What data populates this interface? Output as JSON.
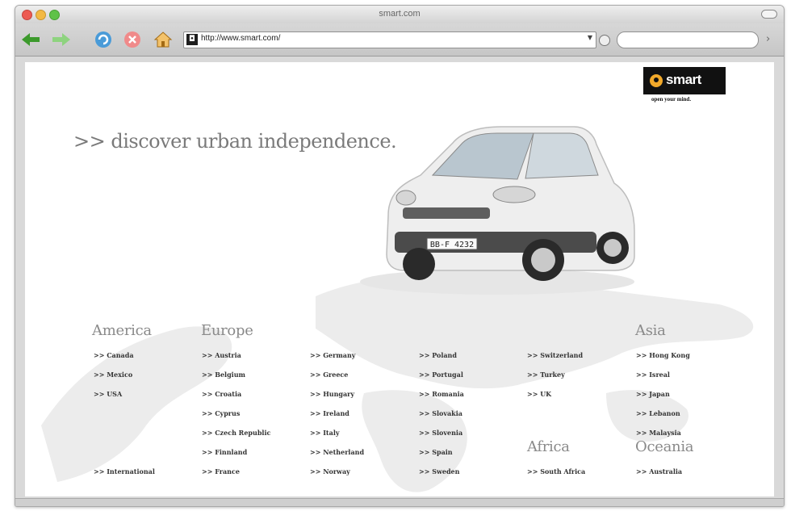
{
  "browser": {
    "title": "smart.com",
    "url": "http://www.smart.com/"
  },
  "brand": {
    "logo_text": "smart",
    "tagline": "open your mind.",
    "accent": "#f2a92a"
  },
  "hero": {
    "headline": ">> discover urban independence.",
    "license_plate": "BB-F 4232"
  },
  "regions": {
    "america": {
      "label": "America",
      "links": [
        ">> Canada",
        ">> Mexico",
        ">> USA"
      ]
    },
    "europe": {
      "label": "Europe"
    },
    "asia": {
      "label": "Asia",
      "links": [
        ">> Hong Kong",
        ">> Isreal",
        ">> Japan",
        ">> Lebanon",
        ">> Malaysia"
      ]
    },
    "africa": {
      "label": "Africa",
      "links": [
        ">> South Africa"
      ]
    },
    "oceania": {
      "label": "Oceania",
      "links": [
        ">> Australia"
      ]
    },
    "international": ">> International"
  },
  "europe_cols": [
    [
      ">> Austria",
      ">> Belgium",
      ">> Croatia",
      ">> Cyprus",
      ">> Czech Republic",
      ">> Finnland",
      ">> France"
    ],
    [
      ">> Germany",
      ">> Greece",
      ">> Hungary",
      ">> Ireland",
      ">> Italy",
      ">> Netherland",
      ">> Norway"
    ],
    [
      ">> Poland",
      ">> Portugal",
      ">> Romania",
      ">> Slovakia",
      ">> Slovenia",
      ">> Spain",
      ">> Sweden"
    ],
    [
      ">> Switzerland",
      ">> Turkey",
      ">> UK"
    ]
  ]
}
